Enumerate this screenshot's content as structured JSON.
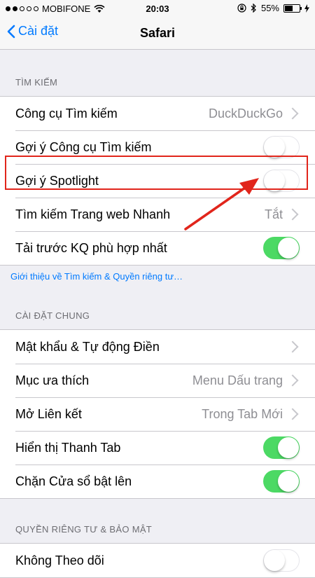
{
  "status": {
    "carrier": "MOBIFONE",
    "time": "20:03",
    "battery_percent": "55%",
    "battery_level": 0.55
  },
  "nav": {
    "back_label": "Cài đặt",
    "title": "Safari"
  },
  "search_section": {
    "header": "TÌM KIẾM",
    "rows": [
      {
        "label": "Công cụ Tìm kiếm",
        "value": "DuckDuckGo"
      },
      {
        "label": "Gợi ý Công cụ Tìm kiếm"
      },
      {
        "label": "Gợi ý Spotlight"
      },
      {
        "label": "Tìm kiếm Trang web Nhanh",
        "value": "Tắt"
      },
      {
        "label": "Tải trước KQ phù hợp nhất"
      }
    ],
    "footer_link": "Giới thiệu về Tìm kiếm & Quyền riêng tư…"
  },
  "general_section": {
    "header": "CÀI ĐẶT CHUNG",
    "rows": [
      {
        "label": "Mật khẩu & Tự động Điền"
      },
      {
        "label": "Mục ưa thích",
        "value": "Menu Dấu trang"
      },
      {
        "label": "Mở Liên kết",
        "value": "Trong Tab Mới"
      },
      {
        "label": "Hiển thị Thanh Tab"
      },
      {
        "label": "Chặn Cửa sổ bật lên"
      }
    ]
  },
  "privacy_section": {
    "header": "QUYỀN RIÊNG TƯ & BẢO MẬT",
    "rows": [
      {
        "label": "Không Theo dõi"
      }
    ]
  },
  "colors": {
    "accent": "#007aff",
    "toggle_on": "#4cd964",
    "highlight": "#e1251b"
  }
}
